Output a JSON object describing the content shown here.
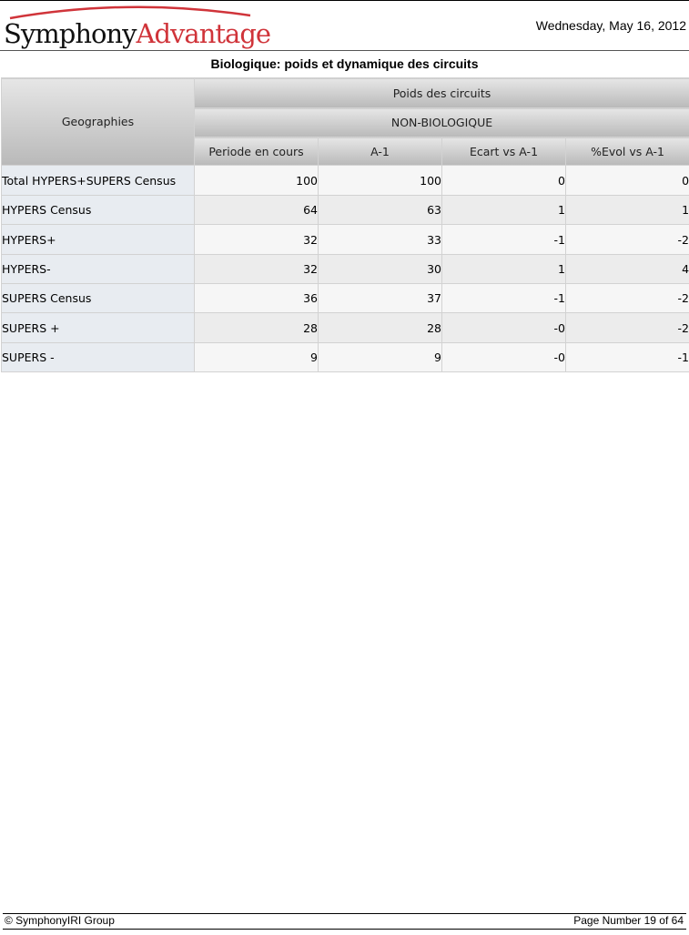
{
  "header": {
    "logo_part1": "Symphony",
    "logo_part2": "Advantage",
    "date": "Wednesday, May 16, 2012"
  },
  "report_title": "Biologique: poids et dynamique des circuits",
  "table": {
    "row_header": "Geographies",
    "group1": "Poids des circuits",
    "group2": "NON-BIOLOGIQUE",
    "columns": [
      "Periode en cours",
      "A-1",
      "Ecart vs A-1",
      "%Evol vs A-1"
    ],
    "rows": [
      {
        "label": "Total HYPERS+SUPERS Census",
        "values": [
          "100",
          "100",
          "0",
          "0"
        ]
      },
      {
        "label": "HYPERS Census",
        "values": [
          "64",
          "63",
          "1",
          "1"
        ]
      },
      {
        "label": "HYPERS+",
        "values": [
          "32",
          "33",
          "-1",
          "-2"
        ]
      },
      {
        "label": "HYPERS-",
        "values": [
          "32",
          "30",
          "1",
          "4"
        ]
      },
      {
        "label": "SUPERS Census",
        "values": [
          "36",
          "37",
          "-1",
          "-2"
        ]
      },
      {
        "label": "SUPERS +",
        "values": [
          "28",
          "28",
          "-0",
          "-2"
        ]
      },
      {
        "label": "SUPERS -",
        "values": [
          "9",
          "9",
          "-0",
          "-1"
        ]
      }
    ]
  },
  "footer": {
    "copyright": "© SymphonyIRI Group",
    "page_number": "Page Number 19 of 64"
  },
  "colors": {
    "logo_accent": "#d0343a",
    "header_gradient_top": "#e6e6e6",
    "header_gradient_bottom": "#b9b9b9",
    "row_label_bg": "#e8ecf1"
  }
}
